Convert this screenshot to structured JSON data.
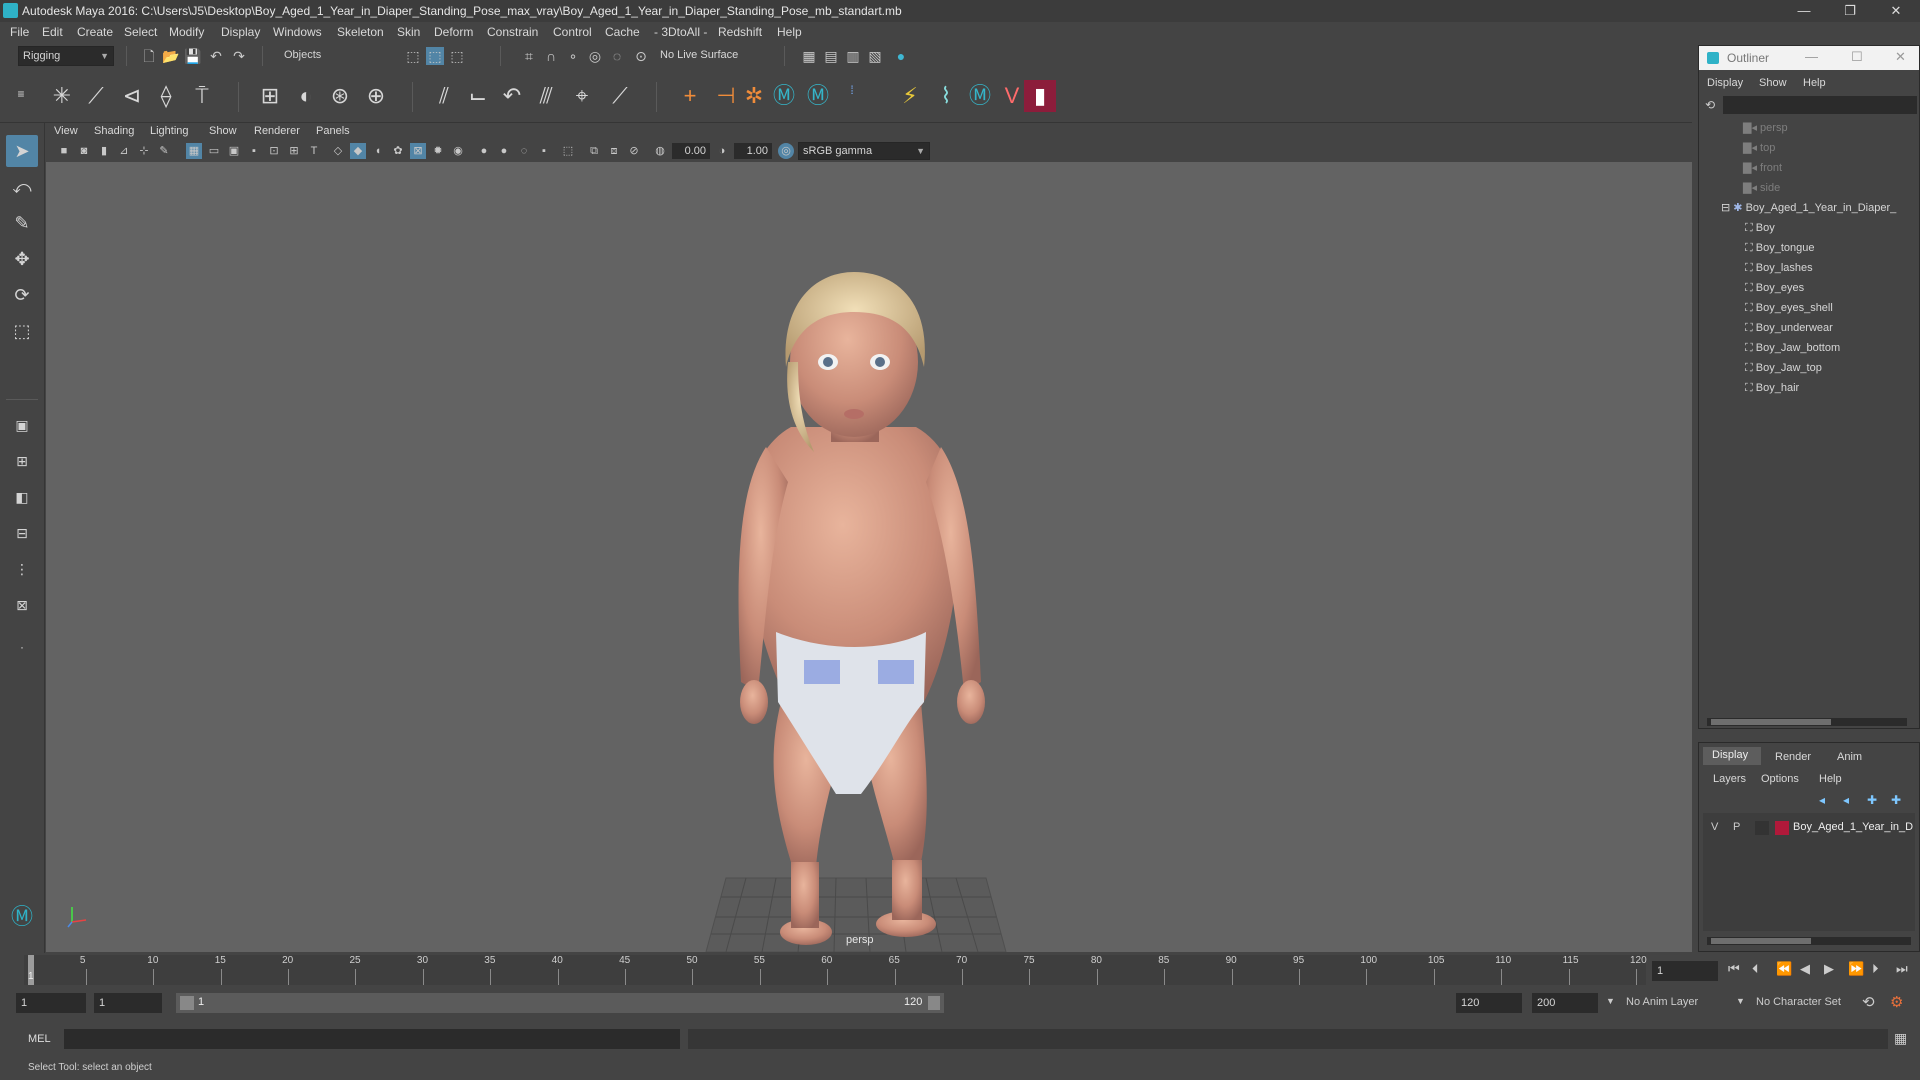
{
  "window": {
    "title": "Autodesk Maya 2016: C:\\Users\\J5\\Desktop\\Boy_Aged_1_Year_in_Diaper_Standing_Pose_max_vray\\Boy_Aged_1_Year_in_Diaper_Standing_Pose_mb_standart.mb",
    "minimize": "—",
    "maximize": "❐",
    "close": "✕"
  },
  "menu": [
    "File",
    "Edit",
    "Create",
    "Select",
    "Modify",
    "Display",
    "Windows",
    "Skeleton",
    "Skin",
    "Deform",
    "Constrain",
    "Control",
    "Cache",
    "- 3DtoAll -",
    "Redshift",
    "Help"
  ],
  "status": {
    "mode": "Rigging",
    "selection_mode": "Objects",
    "live_surface": "No Live Surface"
  },
  "panel": {
    "menu": [
      "View",
      "Shading",
      "Lighting",
      "Show",
      "Renderer",
      "Panels"
    ],
    "exposure": "0.00",
    "gamma": "1.00",
    "color_space": "sRGB gamma"
  },
  "viewport": {
    "camera_label": "persp"
  },
  "outliner": {
    "title": "Outliner",
    "menu": [
      "Display",
      "Show",
      "Help"
    ],
    "cameras": [
      "persp",
      "top",
      "front",
      "side"
    ],
    "group": "Boy_Aged_1_Year_in_Diaper_",
    "children": [
      "Boy",
      "Boy_tongue",
      "Boy_lashes",
      "Boy_eyes",
      "Boy_eyes_shell",
      "Boy_underwear",
      "Boy_Jaw_bottom",
      "Boy_Jaw_top",
      "Boy_hair"
    ]
  },
  "layer_editor": {
    "tabs": [
      "Display",
      "Render",
      "Anim"
    ],
    "menu": [
      "Layers",
      "Options",
      "Help"
    ],
    "layer": {
      "v": "V",
      "p": "P",
      "name": "Boy_Aged_1_Year_in_D",
      "color": "#b0193a"
    }
  },
  "timeline": {
    "ticks": [
      "5",
      "10",
      "15",
      "20",
      "25",
      "30",
      "35",
      "40",
      "45",
      "50",
      "55",
      "60",
      "65",
      "70",
      "75",
      "80",
      "85",
      "90",
      "95",
      "100",
      "105",
      "110",
      "115",
      "120"
    ],
    "current_frame_marker": "1",
    "current_frame": "1"
  },
  "range": {
    "start": "1",
    "anim_start": "1",
    "slider_start": "1",
    "slider_end": "120",
    "anim_end": "120",
    "end": "200",
    "anim_layer": "No Anim Layer",
    "character_set": "No Character Set"
  },
  "cmdline": {
    "label": "MEL"
  },
  "helpline": {
    "text": "Select Tool: select an object"
  },
  "colors": {
    "accent": "#5285a6",
    "maya_teal": "#2fb2c7",
    "viewport_bg": "#636363"
  }
}
